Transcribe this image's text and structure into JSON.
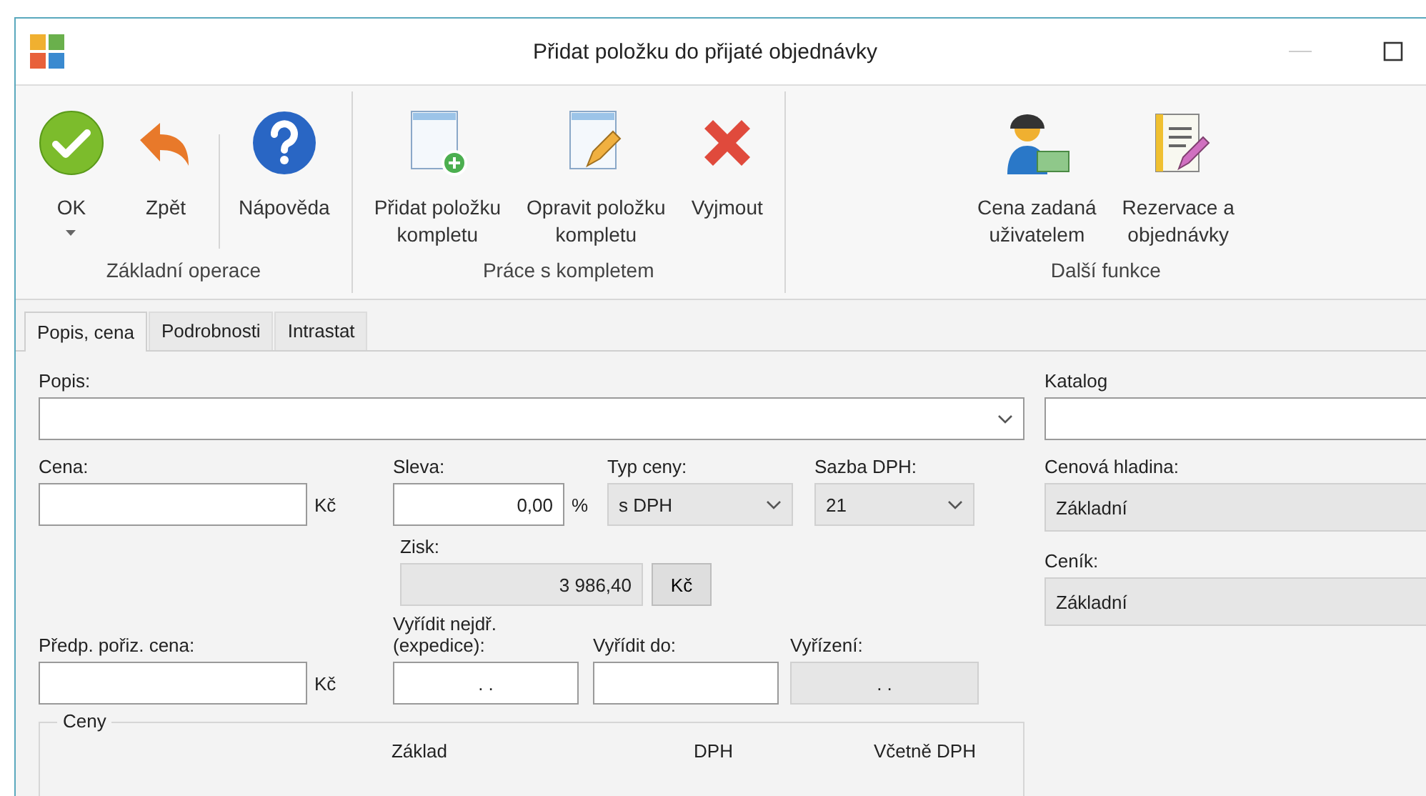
{
  "window": {
    "title": "Přidat položku do přijaté objednávky"
  },
  "ribbon": {
    "groups": [
      {
        "label": "Základní operace",
        "sections": [
          [
            {
              "label": "OK",
              "kind": "ok",
              "has_menu": true
            },
            {
              "label": "Zpět",
              "kind": "back",
              "has_menu": false
            }
          ],
          [
            {
              "label": "Nápověda",
              "kind": "help",
              "has_menu": false
            }
          ]
        ]
      },
      {
        "label": "Práce s kompletem",
        "sections": [
          [
            {
              "label": "Přidat položku\nkompletu",
              "kind": "add-kit",
              "has_menu": false
            },
            {
              "label": "Opravit položku\nkompletu",
              "kind": "edit-kit",
              "has_menu": false
            },
            {
              "label": "Vyjmout",
              "kind": "remove",
              "has_menu": false
            }
          ]
        ]
      },
      {
        "label": "Další funkce",
        "sections": [
          [
            {
              "label": "Cena zadaná\nuživatelem",
              "kind": "user-price",
              "has_menu": false
            },
            {
              "label": "Rezervace a\nobjednávky",
              "kind": "reservation",
              "has_menu": false
            }
          ]
        ]
      }
    ]
  },
  "tabs": [
    {
      "label": "Popis, cena",
      "selected": true
    },
    {
      "label": "Podrobnosti",
      "selected": false
    },
    {
      "label": "Intrastat",
      "selected": false
    }
  ],
  "form": {
    "description": {
      "label": "Popis:"
    },
    "price": {
      "label": "Cena:",
      "unit": "Kč"
    },
    "discount": {
      "label": "Sleva:",
      "value": "0,00",
      "unit": "%"
    },
    "price_type": {
      "label": "Typ ceny:",
      "value": "s DPH",
      "disabled": true
    },
    "vat_rate": {
      "label": "Sazba DPH:",
      "value": "21",
      "disabled": true
    },
    "profit": {
      "label": "Zisk:",
      "value": "3 986,40",
      "unit": "Kč",
      "disabled": true
    },
    "purchase_price": {
      "label": "Předp. pořiz. cena:",
      "unit": "Kč"
    },
    "dispatch_from": {
      "label": "Vyřídit nejdř.\n(expedice):",
      "value": ". .",
      "disabled": false
    },
    "due": {
      "label": "Vyřídit do:",
      "disabled": false
    },
    "settled": {
      "label": "Vyřízení:",
      "value": ". .",
      "disabled": true
    },
    "catalog": {
      "label": "Katalog"
    },
    "price_level": {
      "label": "Cenová hladina:",
      "value": "Základní",
      "disabled": true
    },
    "price_list": {
      "label": "Ceník:",
      "value": "Základní",
      "disabled": true
    },
    "prices": {
      "title": "Ceny",
      "columns": [
        "Základ",
        "DPH",
        "Včetně DPH"
      ]
    }
  }
}
